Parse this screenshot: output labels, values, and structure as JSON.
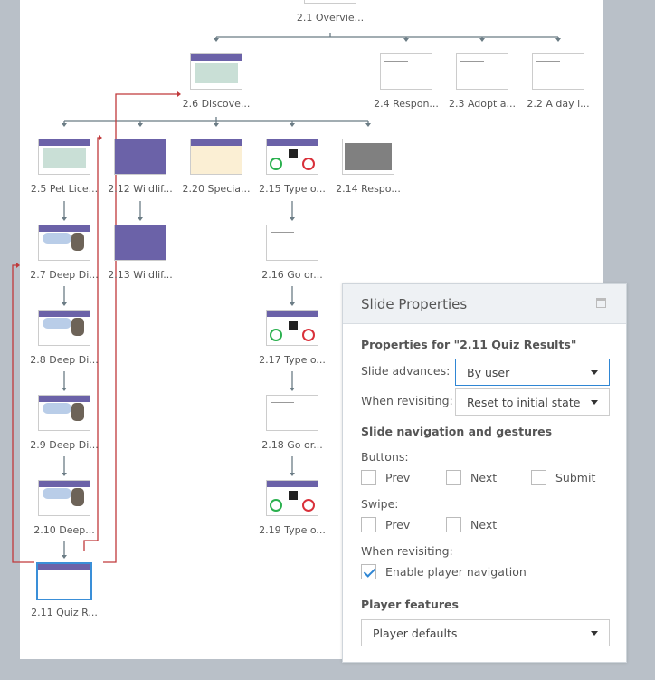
{
  "story": {
    "top_slide": {
      "label": "2.1 Overvie..."
    },
    "slides": [
      {
        "label": "2.6 Discove...",
        "style": "photo"
      },
      {
        "label": "2.4 Respon...",
        "style": "blank"
      },
      {
        "label": "2.3 Adopt a...",
        "style": "blank"
      },
      {
        "label": "2.2 A day i...",
        "style": "blank"
      },
      {
        "label": "2.5 Pet Lice...",
        "style": "photo"
      },
      {
        "label": "2.12 Wildlif...",
        "style": "purple"
      },
      {
        "label": "2.20 Specia...",
        "style": "cream"
      },
      {
        "label": "2.15 Type o...",
        "style": "signs"
      },
      {
        "label": "2.14 Respo...",
        "style": "gray"
      },
      {
        "label": "2.7 Deep Di...",
        "style": "pug"
      },
      {
        "label": "2.13 Wildlif...",
        "style": "purple"
      },
      {
        "label": "2.16 Go or...",
        "style": "blank"
      },
      {
        "label": "2.8 Deep Di...",
        "style": "pug"
      },
      {
        "label": "2.17 Type o...",
        "style": "signs"
      },
      {
        "label": "2.9 Deep Di...",
        "style": "pug"
      },
      {
        "label": "2.18 Go or...",
        "style": "blank"
      },
      {
        "label": "2.10 Deep...",
        "style": "pug"
      },
      {
        "label": "2.19 Type o...",
        "style": "signs"
      },
      {
        "label": "2.11 Quiz R...",
        "style": "selected"
      }
    ]
  },
  "panel": {
    "title": "Slide Properties",
    "properties_for": "Properties for \"2.11 Quiz Results\"",
    "slide_advances_label": "Slide advances:",
    "slide_advances_value": "By user",
    "when_revisiting_label": "When revisiting:",
    "when_revisiting_value": "Reset to initial state",
    "nav_heading": "Slide navigation and gestures",
    "buttons_label": "Buttons:",
    "prev": "Prev",
    "next": "Next",
    "submit": "Submit",
    "swipe_label": "Swipe:",
    "swipe_prev": "Prev",
    "swipe_next": "Next",
    "revisiting_label": "When revisiting:",
    "enable_player_nav": "Enable player navigation",
    "enable_player_nav_checked": true,
    "player_features_heading": "Player features",
    "player_features_value": "Player defaults"
  }
}
